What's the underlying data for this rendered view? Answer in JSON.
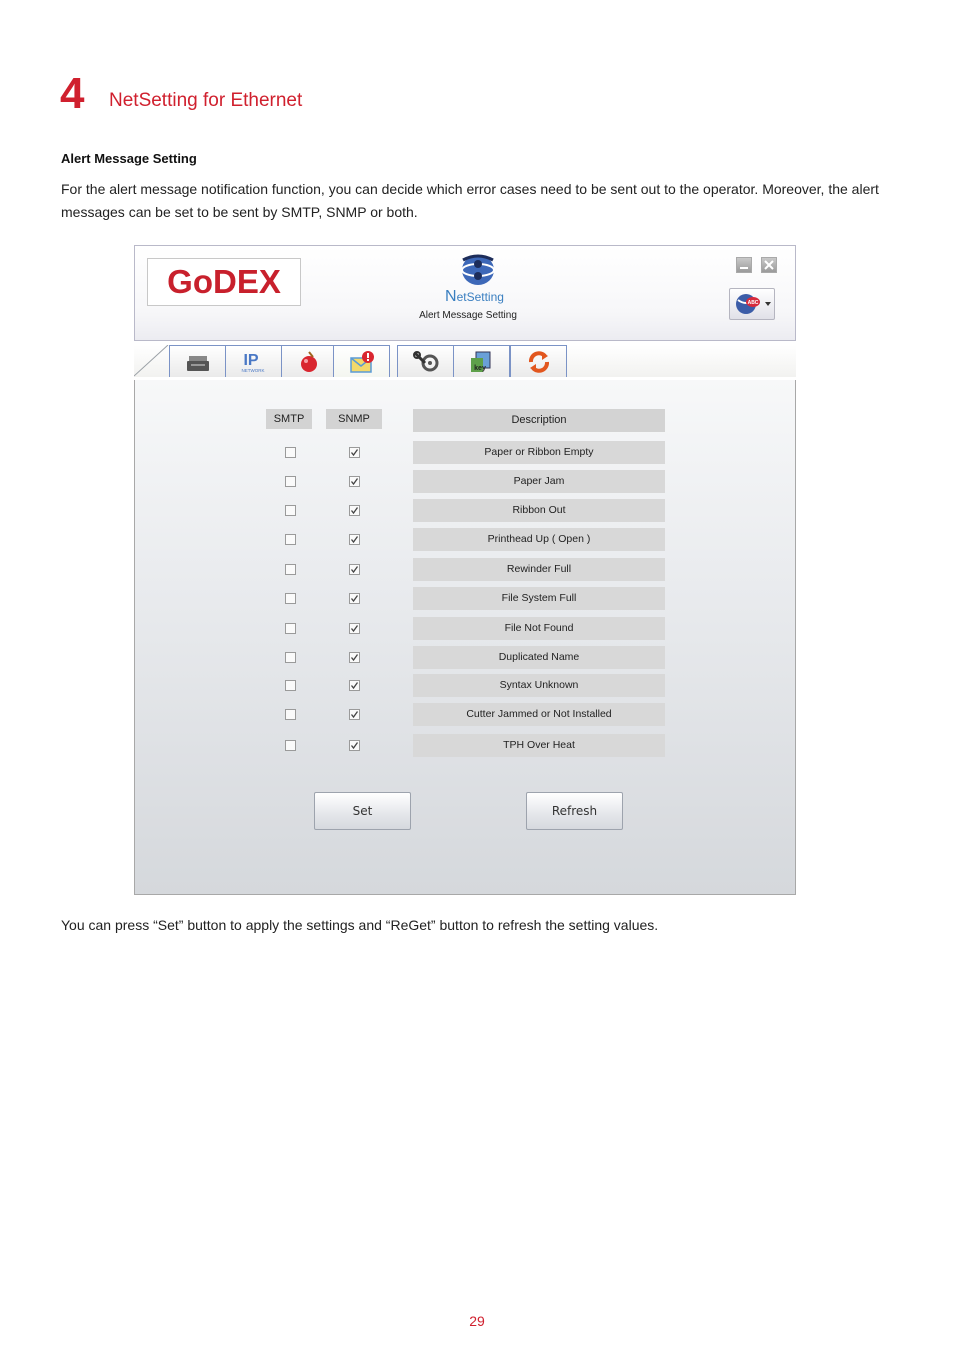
{
  "chapter": {
    "number": "4",
    "title": "NetSetting for Ethernet"
  },
  "section": {
    "heading": "Alert Message Setting"
  },
  "intro_text": "For the alert message notification function, you can decide which error cases need to be sent out to the operator. Moreover, the alert messages can be set to be sent by SMTP, SNMP or both.",
  "app": {
    "logo_text": "GoDEX",
    "brand_prefix": "N",
    "brand_rest": "etSetting",
    "header_title": "Alert Message Setting",
    "lang_badge": "ABC",
    "tabs": [
      {
        "icon": "printer-icon",
        "active": false
      },
      {
        "icon": "ip-network-icon",
        "active": false,
        "text": "IP",
        "subtext": "NETWORK"
      },
      {
        "icon": "alert-bell-icon",
        "active": false
      },
      {
        "icon": "mail-alert-icon",
        "active": true
      },
      {
        "icon": "tools-icon",
        "active": false
      },
      {
        "icon": "key-window-icon",
        "active": false,
        "text": "key"
      },
      {
        "icon": "refresh-arrows-icon",
        "active": false
      }
    ],
    "columns": {
      "smtp": "SMTP",
      "snmp": "SNMP",
      "description": "Description"
    },
    "rows": [
      {
        "description": "Paper or Ribbon Empty",
        "smtp": false,
        "snmp": true
      },
      {
        "description": "Paper Jam",
        "smtp": false,
        "snmp": true
      },
      {
        "description": "Ribbon Out",
        "smtp": false,
        "snmp": true
      },
      {
        "description": "Printhead Up ( Open )",
        "smtp": false,
        "snmp": true
      },
      {
        "description": "Rewinder Full",
        "smtp": false,
        "snmp": true
      },
      {
        "description": "File System Full",
        "smtp": false,
        "snmp": true
      },
      {
        "description": "File Not Found",
        "smtp": false,
        "snmp": true
      },
      {
        "description": "Duplicated Name",
        "smtp": false,
        "snmp": true
      },
      {
        "description": "Syntax Unknown",
        "smtp": false,
        "snmp": true
      },
      {
        "description": "Cutter Jammed or Not Installed",
        "smtp": false,
        "snmp": true
      },
      {
        "description": "TPH Over Heat",
        "smtp": false,
        "snmp": true
      }
    ],
    "buttons": {
      "set": "Set",
      "refresh": "Refresh"
    },
    "colors": {
      "accent": "#d0202e",
      "tab_border": "#7b93c6",
      "tab_underline": "#d7e89a"
    }
  },
  "footer_text": "You can press “Set” button to apply the settings and “ReGet” button to refresh the setting values.",
  "page_number": "29"
}
